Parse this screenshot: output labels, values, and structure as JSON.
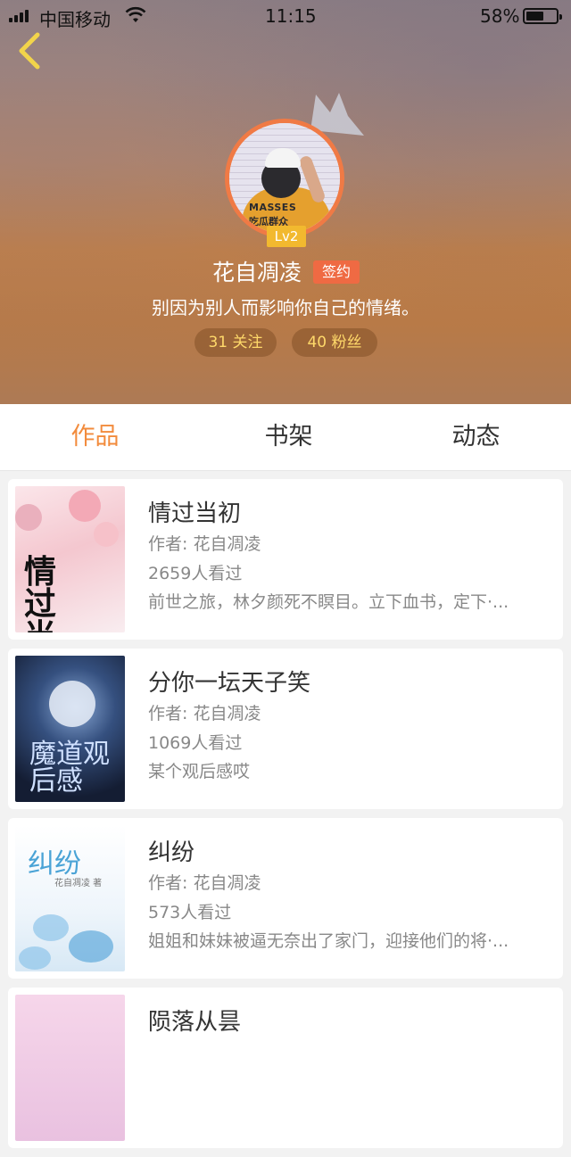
{
  "status_bar": {
    "carrier": "中国移动",
    "time": "11:15",
    "battery": "58%",
    "battery_level": 0.58
  },
  "profile": {
    "level": "Lv2",
    "name": "花自凋凌",
    "badge": "签约",
    "bio": "别因为别人而影响你自己的情绪。",
    "follow": "31 关注",
    "fans": "40 粉丝",
    "avatar_text_1": "MASSES",
    "avatar_text_2": "吃瓜群众"
  },
  "tabs": [
    {
      "label": "作品",
      "active": true
    },
    {
      "label": "书架",
      "active": false
    },
    {
      "label": "动态",
      "active": false
    }
  ],
  "books": [
    {
      "title": "情过当初",
      "author": "作者: 花自凋凌",
      "views": "2659人看过",
      "desc": "前世之旅，林夕颜死不瞑目。立下血书，定下·...",
      "cover_text": "情过当初",
      "cover_sub": ""
    },
    {
      "title": "分你一坛天子笑",
      "author": "作者: 花自凋凌",
      "views": "1069人看过",
      "desc": "某个观后感哎",
      "cover_text": "魔道观后感",
      "cover_sub": ""
    },
    {
      "title": "纠纷",
      "author": "作者: 花自凋凌",
      "views": "573人看过",
      "desc": "姐姐和妹妹被逼无奈出了家门，迎接他们的将·...",
      "cover_text": "纠纷",
      "cover_sub": "花自凋凌 著"
    },
    {
      "title": "陨落从昙",
      "author": "",
      "views": "",
      "desc": "",
      "cover_text": "",
      "cover_sub": ""
    }
  ],
  "colors": {
    "accent": "#f28b3c",
    "badge": "#ef6a43",
    "level": "#f2b92f",
    "pill_text": "#ffd96a"
  },
  "icons": {
    "back": "chevron-left-icon",
    "crown": "crown-icon",
    "wifi": "wifi-icon",
    "signal": "signal-icon",
    "battery": "battery-icon"
  }
}
